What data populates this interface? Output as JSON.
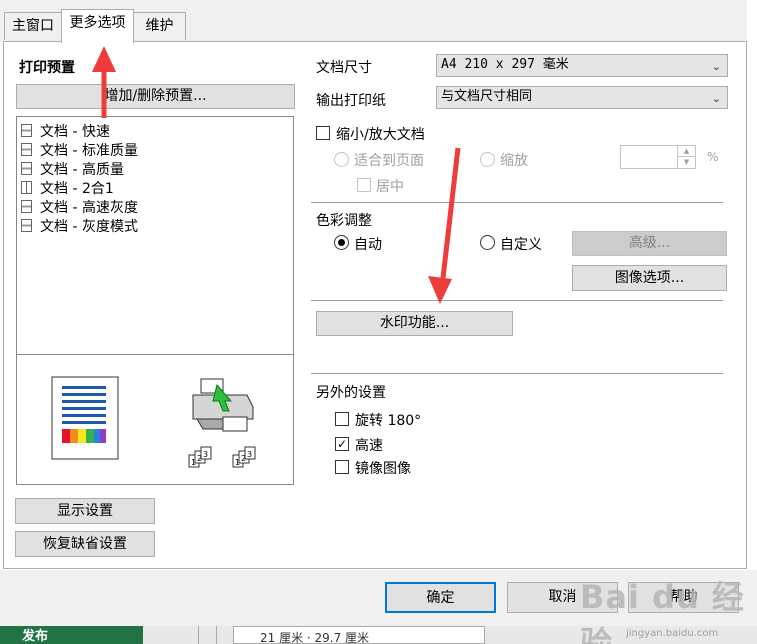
{
  "tabs": [
    {
      "label": "主窗口"
    },
    {
      "label": "更多选项"
    },
    {
      "label": "维护"
    }
  ],
  "left": {
    "presets_heading": "打印预置",
    "add_remove_button": "增加/删除预置...",
    "presets": [
      "文档 - 快速",
      "文档 - 标准质量",
      "文档 - 高质量",
      "文档 - 2合1",
      "文档 - 高速灰度",
      "文档 - 灰度模式"
    ],
    "show_settings_button": "显示设置",
    "restore_defaults_button": "恢复缺省设置"
  },
  "right": {
    "doc_size_label": "文档尺寸",
    "doc_size_value": "A4 210 x 297 毫米",
    "output_paper_label": "输出打印纸",
    "output_paper_value": "与文档尺寸相同",
    "reduce_enlarge_label": "缩小/放大文档",
    "fit_to_page_label": "适合到页面",
    "zoom_label": "缩放",
    "percent_symbol": "%",
    "center_label": "居中",
    "color_adjust_heading": "色彩调整",
    "auto_label": "自动",
    "custom_label": "自定义",
    "advanced_button": "高级...",
    "image_options_button": "图像选项...",
    "watermark_button": "水印功能...",
    "extra_settings_heading": "另外的设置",
    "rotate_label": "旋转 180°",
    "high_speed_label": "高速",
    "mirror_label": "镜像图像"
  },
  "footer": {
    "ok_button": "确定",
    "cancel_button": "取消",
    "help_button": "帮助"
  },
  "background": {
    "green_tab_text": "发布",
    "ruler_text": "21 厘米 · 29.7 厘米"
  },
  "watermark": {
    "brand": "Bai du 经验",
    "url": "jingyan.baidu.com"
  },
  "state": {
    "reduce_enlarge_checked": false,
    "auto_selected": true,
    "rotate_checked": false,
    "high_speed_checked": true,
    "mirror_checked": false
  },
  "colors": {
    "accent_border": "#0078d7",
    "annotation_arrow": "#ef3b3b",
    "taskbar_green": "#217346"
  }
}
